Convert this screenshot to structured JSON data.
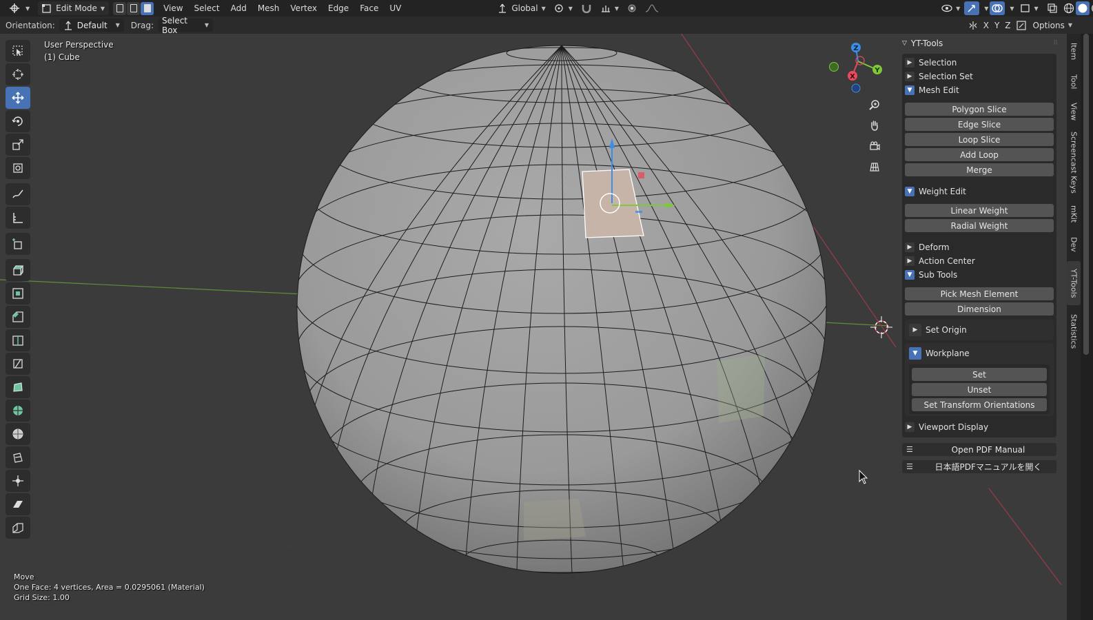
{
  "header": {
    "mode": "Edit Mode",
    "menus": [
      "View",
      "Select",
      "Add",
      "Mesh",
      "Vertex",
      "Edge",
      "Face",
      "UV"
    ],
    "transform_orientation": "Global"
  },
  "tool_settings": {
    "orientation_label": "Orientation:",
    "orientation_value": "Default",
    "drag_label": "Drag:",
    "drag_value": "Select Box",
    "axes": [
      "X",
      "Y",
      "Z"
    ],
    "options_label": "Options"
  },
  "viewport": {
    "perspective": "User Perspective",
    "object": "(1) Cube",
    "gizmo_axes": [
      "Z",
      "Y",
      "X"
    ]
  },
  "status": {
    "operator": "Move",
    "info": "One Face: 4 vertices,  Area = 0.0295061 (Material)",
    "grid": "Grid Size: 1.00"
  },
  "npanel": {
    "title": "YT-Tools",
    "section_selection": "Selection",
    "section_selection_set": "Selection Set",
    "section_mesh_edit": "Mesh Edit",
    "mesh_edit_buttons": [
      "Polygon Slice",
      "Edge Slice",
      "Loop Slice",
      "Add Loop",
      "Merge"
    ],
    "section_weight_edit": "Weight Edit",
    "weight_buttons": [
      "Linear Weight",
      "Radial Weight"
    ],
    "section_deform": "Deform",
    "section_action_center": "Action Center",
    "section_sub_tools": "Sub Tools",
    "sub_tools_buttons": [
      "Pick Mesh Element",
      "Dimension"
    ],
    "set_origin": "Set Origin",
    "workplane": "Workplane",
    "workplane_buttons": [
      "Set",
      "Unset",
      "Set Transform Orientations"
    ],
    "section_viewport_display": "Viewport Display",
    "pdf_manual": "Open PDF Manual",
    "pdf_manual_jp": "日本語PDFマニュアルを開く"
  },
  "side_tabs": [
    "Item",
    "Tool",
    "View",
    "Screencast Keys",
    "mKit",
    "Dev",
    "YT-Tools",
    "Statistics"
  ],
  "colors": {
    "accent": "#4772b3",
    "axis_x": "#e84a5f",
    "axis_y": "#7ec83a",
    "axis_z": "#3a8ee6",
    "selected_face": "#c7b4a8"
  }
}
